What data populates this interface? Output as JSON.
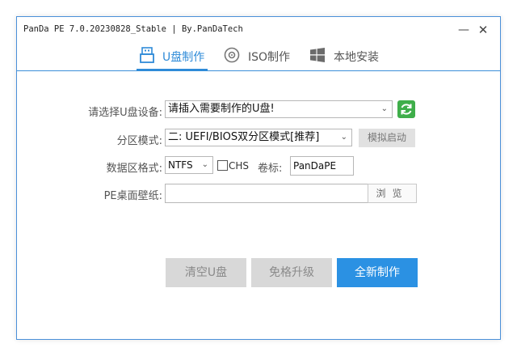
{
  "window": {
    "title": "PanDa PE 7.0.20230828_Stable | By.PanDaTech",
    "minimize_glyph": "—",
    "close_glyph": "✕"
  },
  "tabs": [
    {
      "label": "U盘制作",
      "icon": "usb-icon",
      "active": true
    },
    {
      "label": "ISO制作",
      "icon": "disc-icon",
      "active": false
    },
    {
      "label": "本地安装",
      "icon": "windows-icon",
      "active": false
    }
  ],
  "form": {
    "device_label": "请选择U盘设备:",
    "device_value": "请插入需要制作的U盘!",
    "partition_label": "分区模式:",
    "partition_value": "二: UEFI/BIOS双分区模式[推荐]",
    "simulate_button": "模拟启动",
    "format_label": "数据区格式:",
    "format_value": "NTFS",
    "chs_label": "CHS",
    "volume_label": "卷标:",
    "volume_value": "PanDaPE",
    "wallpaper_label": "PE桌面壁纸:",
    "wallpaper_value": "",
    "browse_button": "浏览"
  },
  "actions": {
    "clear_label": "清空U盘",
    "upgrade_label": "免格升级",
    "new_label": "全新制作"
  },
  "colors": {
    "accent": "#2f8bd8",
    "primary_button": "#2b91e3",
    "refresh_green": "#3fae4a",
    "disabled_button": "#d8d8d8"
  }
}
